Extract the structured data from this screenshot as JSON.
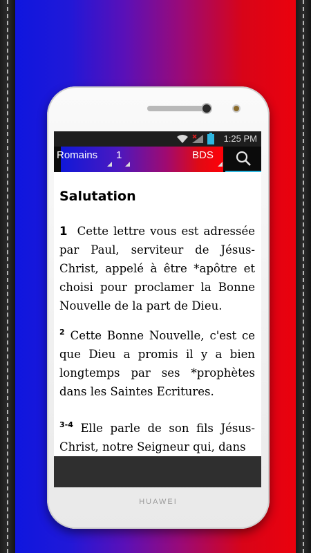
{
  "status_bar": {
    "time": "1:25 PM",
    "icons": [
      "wifi-icon",
      "no-signal-icon",
      "battery-icon"
    ]
  },
  "toolbar": {
    "book": "Romains",
    "chapter": "1",
    "version": "BDS",
    "search_icon": "search-icon"
  },
  "content": {
    "section_title": "Salutation",
    "verses": [
      {
        "number": "1",
        "text": "Cette lettre vous est adressée par Paul, serviteur de Jésus-Christ, appelé à être *apôtre et choisi pour proclamer la Bonne Nouvelle de la part de Dieu."
      },
      {
        "number": "2",
        "text": "Cette Bonne Nouvelle, c'est ce que Dieu a promis il y a bien longtemps par ses *prophètes dans les Saintes Ecritures."
      },
      {
        "number": "3-4",
        "text": "Elle parle de son fils Jésus-Christ, notre Seigneur qui, dans"
      }
    ]
  },
  "device": {
    "brand": "HUAWEI"
  },
  "colors": {
    "accent": "#2fb7e0",
    "blue": "#0a16e0",
    "red": "#f0000a"
  }
}
